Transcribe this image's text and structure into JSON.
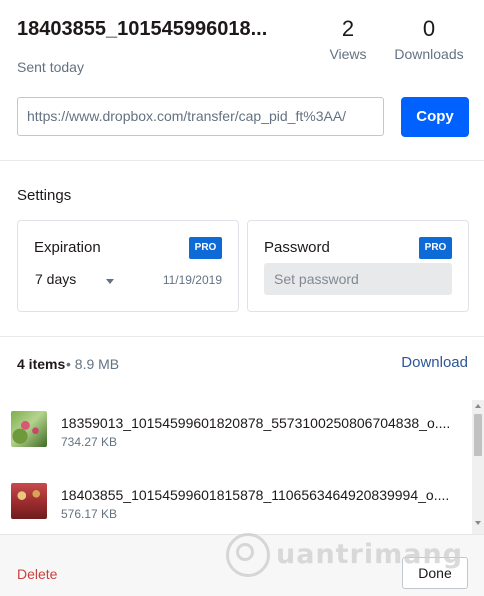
{
  "header": {
    "title": "18403855_101545996018...",
    "subtitle": "Sent today",
    "views": {
      "count": "2",
      "label": "Views"
    },
    "downloads": {
      "count": "0",
      "label": "Downloads"
    },
    "link_value": "https://www.dropbox.com/transfer/cap_pid_ft%3AA/",
    "copy_label": "Copy"
  },
  "settings": {
    "heading": "Settings",
    "expiration": {
      "title": "Expiration",
      "badge": "PRO",
      "value": "7 days",
      "date": "11/19/2019",
      "icon": "chevron-down-icon"
    },
    "password": {
      "title": "Password",
      "badge": "PRO",
      "placeholder": "Set password"
    }
  },
  "items": {
    "count": "4 items",
    "size": " • 8.9 MB",
    "download_label": "Download",
    "files": [
      {
        "name": "18359013_10154599601820878_5573100250806704838_o....",
        "size": "734.27 KB"
      },
      {
        "name": "18403855_10154599601815878_1106563464920839994_o....",
        "size": "576.17 KB"
      }
    ]
  },
  "footer": {
    "delete_label": "Delete",
    "done_label": "Done"
  },
  "watermark": {
    "text": "uantrimang"
  },
  "colors": {
    "accent": "#0061fe",
    "pro_badge": "#0d6ad6",
    "delete": "#c7423f",
    "link": "#2d5796"
  }
}
